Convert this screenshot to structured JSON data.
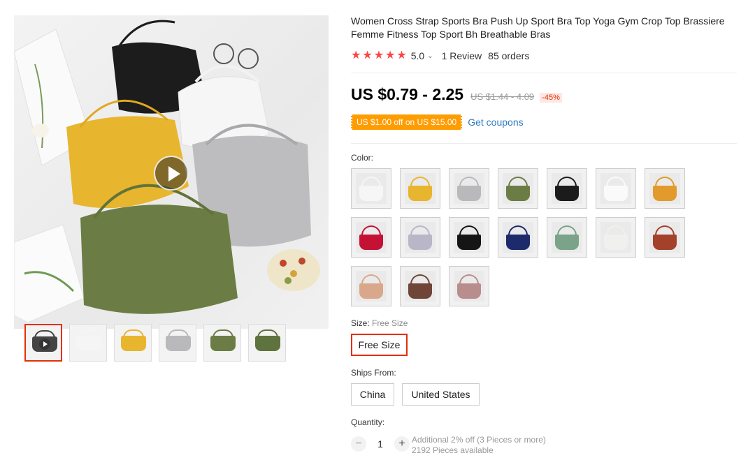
{
  "product": {
    "title": "Women Cross Strap Sports Bra Push Up Sport Bra Top Yoga Gym Crop Top Brassiere Femme Fitness Top Sport Bh Breathable Bras",
    "rating": "5.0",
    "rating_stars": 5,
    "reviews": "1 Review",
    "orders": "85 orders"
  },
  "price": {
    "current": "US $0.79 - 2.25",
    "original": "US $1.44 - 4.09",
    "discount": "-45%"
  },
  "coupon": {
    "badge": "US $1.00 off on US $15.00",
    "link": "Get coupons"
  },
  "color": {
    "label": "Color:",
    "swatches": [
      {
        "name": "white",
        "color": "#f6f6f6"
      },
      {
        "name": "yellow",
        "color": "#e8b52e"
      },
      {
        "name": "gray",
        "color": "#b9b9bb"
      },
      {
        "name": "army-green",
        "color": "#6b7d44"
      },
      {
        "name": "black",
        "color": "#1b1b1b"
      },
      {
        "name": "light-white",
        "color": "#fafafa"
      },
      {
        "name": "orange",
        "color": "#e29a2c"
      },
      {
        "name": "red",
        "color": "#c41235"
      },
      {
        "name": "lavender",
        "color": "#b9b6c8"
      },
      {
        "name": "black-2",
        "color": "#151515"
      },
      {
        "name": "navy",
        "color": "#1d2a6b"
      },
      {
        "name": "sage-green",
        "color": "#7aa38a"
      },
      {
        "name": "ivory",
        "color": "#f0f0ee"
      },
      {
        "name": "rust",
        "color": "#a3412a"
      },
      {
        "name": "beige",
        "color": "#d9a88a"
      },
      {
        "name": "brown",
        "color": "#6e4536"
      },
      {
        "name": "dusty-pink",
        "color": "#b98d8c"
      }
    ]
  },
  "size": {
    "label": "Size:",
    "selected_value": "Free Size",
    "options": [
      "Free Size"
    ]
  },
  "ships_from": {
    "label": "Ships From:",
    "options": [
      "China",
      "United States"
    ]
  },
  "quantity": {
    "label": "Quantity:",
    "minus": "−",
    "value": "1",
    "plus": "+",
    "note_discount": "Additional 2% off (3 Pieces or more)",
    "note_available": "2192 Pieces available"
  },
  "gallery": {
    "thumbs": [
      {
        "name": "mixed-video",
        "color": "#444444"
      },
      {
        "name": "white",
        "color": "#f5f5f5"
      },
      {
        "name": "yellow",
        "color": "#e8b52e"
      },
      {
        "name": "gray",
        "color": "#b9b9bb"
      },
      {
        "name": "green",
        "color": "#6b7d44"
      },
      {
        "name": "green-2",
        "color": "#5f733e"
      }
    ]
  }
}
